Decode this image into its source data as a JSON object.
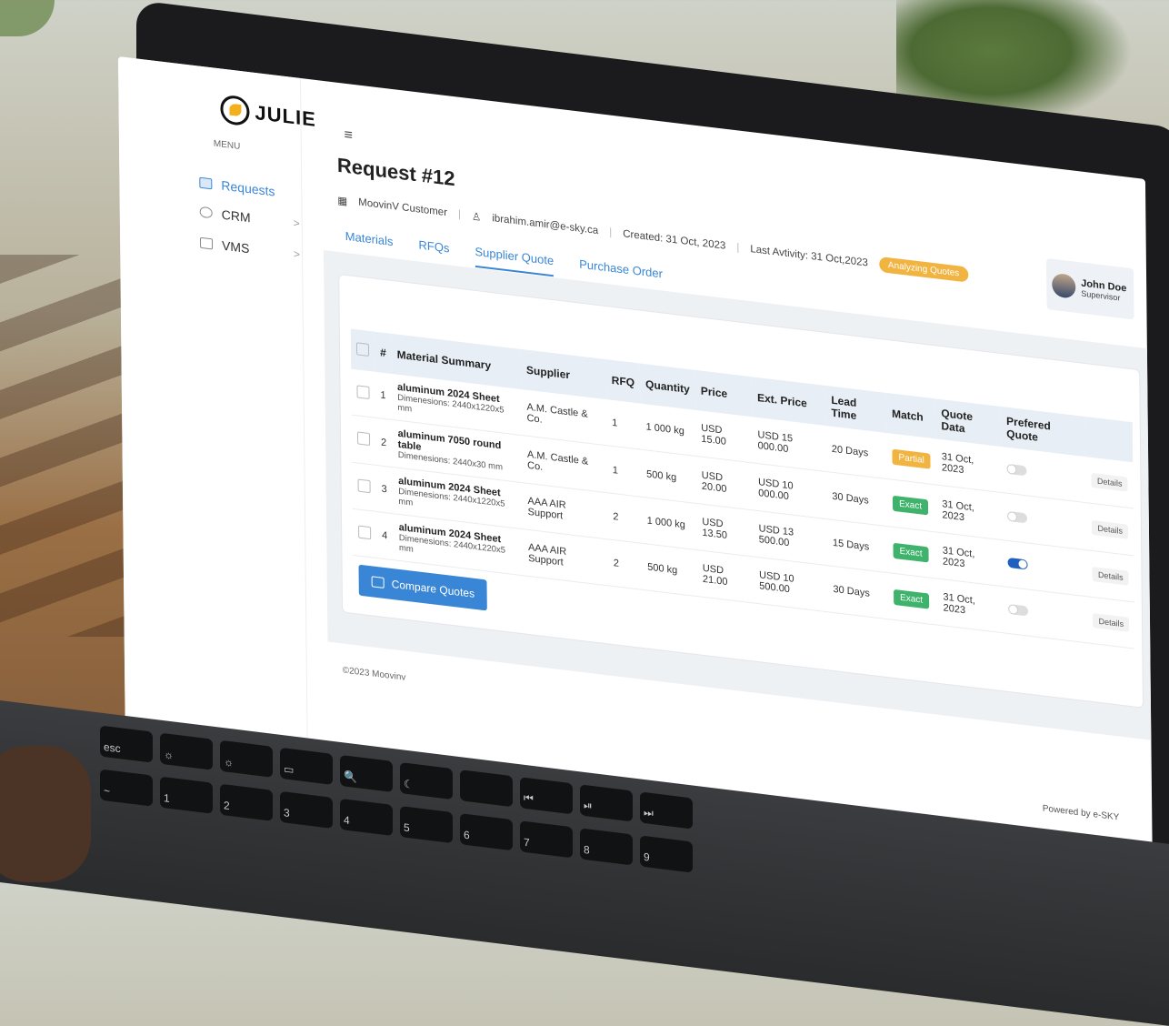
{
  "brand": {
    "logo_text": "JULIE",
    "menu_label": "MENU"
  },
  "sidebar": {
    "items": [
      {
        "label": "Requests",
        "icon": "requests-icon",
        "active": true
      },
      {
        "label": "CRM",
        "icon": "crm-icon",
        "chevron": ">"
      },
      {
        "label": "VMS",
        "icon": "vms-icon",
        "chevron": ">"
      }
    ]
  },
  "header": {
    "menu_icon": "≡",
    "title": "Request #12",
    "customer": "MoovinV Customer",
    "email": "ibrahim.amir@e-sky.ca",
    "created": "Created: 31 Oct, 2023",
    "last_activity": "Last Avtivity: 31 Oct,2023",
    "status_badge": "Analyzing Quotes"
  },
  "user": {
    "name": "John Doe",
    "role": "Supervisor"
  },
  "tabs": [
    {
      "label": "Materials"
    },
    {
      "label": "RFQs"
    },
    {
      "label": "Supplier Quote",
      "active": true
    },
    {
      "label": "Purchase Order"
    }
  ],
  "table": {
    "headers": [
      "#",
      "Material Summary",
      "Supplier",
      "RFQ",
      "Quantity",
      "Price",
      "Ext. Price",
      "Lead Time",
      "Match",
      "Quote Data",
      "Prefered Quote"
    ],
    "rows": [
      {
        "num": "1",
        "name": "aluminum 2024 Sheet",
        "dim": "Dimenesions: 2440x1220x5 mm",
        "supplier": "A.M. Castle & Co.",
        "rfq": "1",
        "quantity": "1 000 kg",
        "price": "USD 15.00",
        "ext_price": "USD 15 000.00",
        "lead": "20 Days",
        "match": "Partial",
        "quote_date": "31 Oct, 2023",
        "preferred": false,
        "details": "Details"
      },
      {
        "num": "2",
        "name": "aluminum 7050 round table",
        "dim": "Dimenesions: 2440x30 mm",
        "supplier": "A.M. Castle & Co.",
        "rfq": "1",
        "quantity": "500 kg",
        "price": "USD 20.00",
        "ext_price": "USD 10 000.00",
        "lead": "30 Days",
        "match": "Exact",
        "quote_date": "31 Oct, 2023",
        "preferred": false,
        "details": "Details"
      },
      {
        "num": "3",
        "name": "aluminum 2024 Sheet",
        "dim": "Dimenesions: 2440x1220x5 mm",
        "supplier": "AAA AIR Support",
        "rfq": "2",
        "quantity": "1 000 kg",
        "price": "USD 13.50",
        "ext_price": "USD 13 500.00",
        "lead": "15 Days",
        "match": "Exact",
        "quote_date": "31 Oct, 2023",
        "preferred": true,
        "details": "Details"
      },
      {
        "num": "4",
        "name": "aluminum 2024 Sheet",
        "dim": "Dimenesions: 2440x1220x5 mm",
        "supplier": "AAA AIR Support",
        "rfq": "2",
        "quantity": "500 kg",
        "price": "USD 21.00",
        "ext_price": "USD 10 500.00",
        "lead": "30 Days",
        "match": "Exact",
        "quote_date": "31 Oct, 2023",
        "preferred": false,
        "details": "Details"
      }
    ]
  },
  "compare_button": {
    "label": "Compare Quotes"
  },
  "footer": {
    "copyright": "©2023 Moovinv",
    "powered": "Powered by e-SKY"
  },
  "keyboard": {
    "row1": [
      "esc",
      "☼",
      "☼",
      "▭",
      "🔍",
      "☾",
      "",
      "⏮",
      "⏯",
      "⏭"
    ],
    "row2": [
      "~",
      "1",
      "2",
      "3",
      "4",
      "5",
      "6",
      "7",
      "8",
      "9"
    ]
  },
  "colors": {
    "accent": "#3a86d6",
    "partial": "#f2b441",
    "exact": "#3fb36b",
    "badge": "#f2b441"
  }
}
